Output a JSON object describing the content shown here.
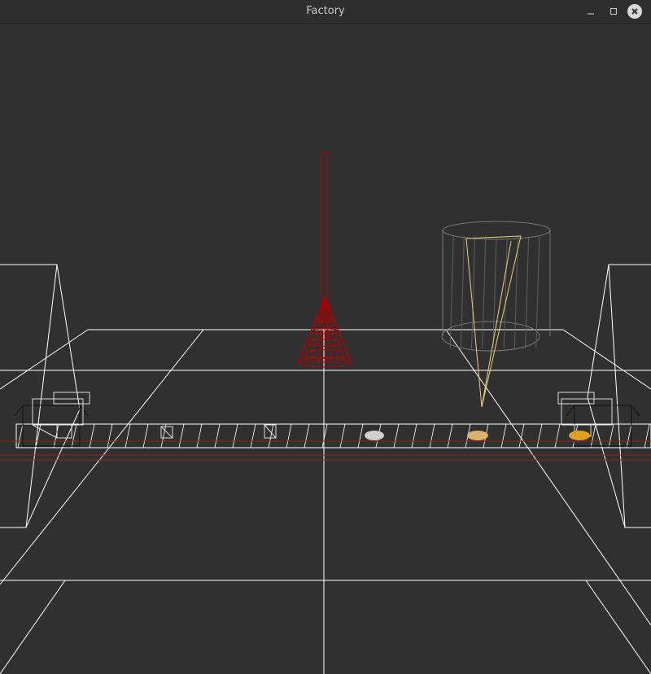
{
  "window": {
    "title": "Factory"
  },
  "colors": {
    "background": "#303030",
    "grid": "#ffffff",
    "lamp": "#b00000",
    "spotlight": "#e8d27a",
    "belt_rail": "#8a2a1a",
    "item_gray": "#d0d0d0",
    "item_tan": "#d9b36a",
    "item_gold": "#e0a020"
  },
  "icons": {
    "minimize": "minimize-icon",
    "maximize": "maximize-icon",
    "close": "close-icon"
  }
}
